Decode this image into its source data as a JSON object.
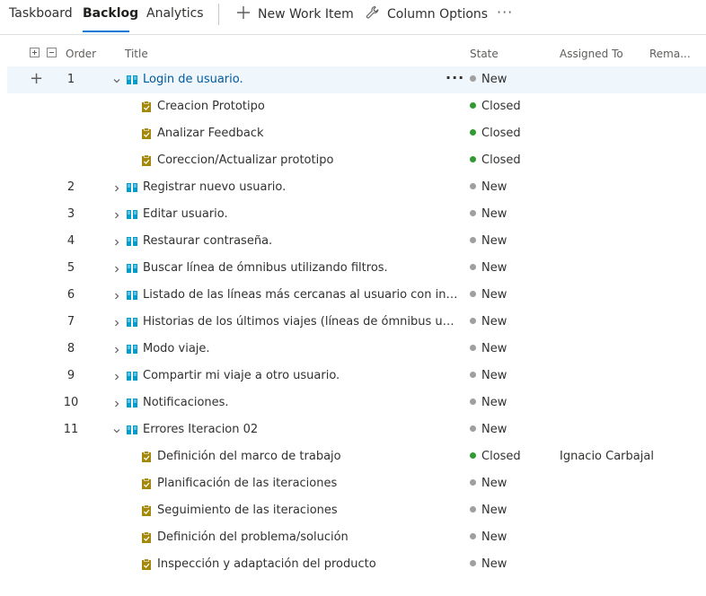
{
  "tabs": [
    {
      "label": "Taskboard",
      "active": false
    },
    {
      "label": "Backlog",
      "active": true
    },
    {
      "label": "Analytics",
      "active": false
    }
  ],
  "toolbar": {
    "new_work_item": "New Work Item",
    "column_options": "Column Options",
    "more": "···"
  },
  "columns": {
    "order": "Order",
    "title": "Title",
    "state": "State",
    "assigned_to": "Assigned To",
    "remaining": "Rema..."
  },
  "colors": {
    "new": "#a19f9d",
    "closed": "#339933",
    "story_icon": "#009ccc",
    "task_icon": "#a4880a",
    "accent": "#0078d4"
  },
  "rows": [
    {
      "order": "1",
      "kind": "story",
      "expanded": true,
      "title": "Login de usuario.",
      "state": "New",
      "assigned": "",
      "selected": true
    },
    {
      "order": "",
      "kind": "task",
      "title": "Creacion Prototipo",
      "state": "Closed",
      "assigned": ""
    },
    {
      "order": "",
      "kind": "task",
      "title": "Analizar Feedback",
      "state": "Closed",
      "assigned": ""
    },
    {
      "order": "",
      "kind": "task",
      "title": "Coreccion/Actualizar prototipo",
      "state": "Closed",
      "assigned": ""
    },
    {
      "order": "2",
      "kind": "story",
      "expanded": false,
      "title": "Registrar nuevo usuario.",
      "state": "New",
      "assigned": ""
    },
    {
      "order": "3",
      "kind": "story",
      "expanded": false,
      "title": "Editar usuario.",
      "state": "New",
      "assigned": ""
    },
    {
      "order": "4",
      "kind": "story",
      "expanded": false,
      "title": "Restaurar contraseña.",
      "state": "New",
      "assigned": ""
    },
    {
      "order": "5",
      "kind": "story",
      "expanded": false,
      "title": "Buscar línea de ómnibus utilizando filtros.",
      "state": "New",
      "assigned": ""
    },
    {
      "order": "6",
      "kind": "story",
      "expanded": false,
      "title": "Listado de las líneas más cercanas al usuario con informació…",
      "state": "New",
      "assigned": ""
    },
    {
      "order": "7",
      "kind": "story",
      "expanded": false,
      "title": "Historias de los últimos viajes (líneas de ómnibus utilizadas).",
      "state": "New",
      "assigned": ""
    },
    {
      "order": "8",
      "kind": "story",
      "expanded": false,
      "title": "Modo viaje.",
      "state": "New",
      "assigned": ""
    },
    {
      "order": "9",
      "kind": "story",
      "expanded": false,
      "title": "Compartir mi viaje a otro usuario.",
      "state": "New",
      "assigned": ""
    },
    {
      "order": "10",
      "kind": "story",
      "expanded": false,
      "title": "Notificaciones.",
      "state": "New",
      "assigned": ""
    },
    {
      "order": "11",
      "kind": "story",
      "expanded": true,
      "title": "Errores Iteracion 02",
      "state": "New",
      "assigned": ""
    },
    {
      "order": "",
      "kind": "task",
      "title": "Definición del marco de trabajo",
      "state": "Closed",
      "assigned": "Ignacio Carbajal"
    },
    {
      "order": "",
      "kind": "task",
      "title": "Planificación de las iteraciones",
      "state": "New",
      "assigned": ""
    },
    {
      "order": "",
      "kind": "task",
      "title": "Seguimiento de las iteraciones",
      "state": "New",
      "assigned": ""
    },
    {
      "order": "",
      "kind": "task",
      "title": "Definición del problema/solución",
      "state": "New",
      "assigned": ""
    },
    {
      "order": "",
      "kind": "task",
      "title": "Inspección y adaptación del producto",
      "state": "New",
      "assigned": ""
    }
  ]
}
